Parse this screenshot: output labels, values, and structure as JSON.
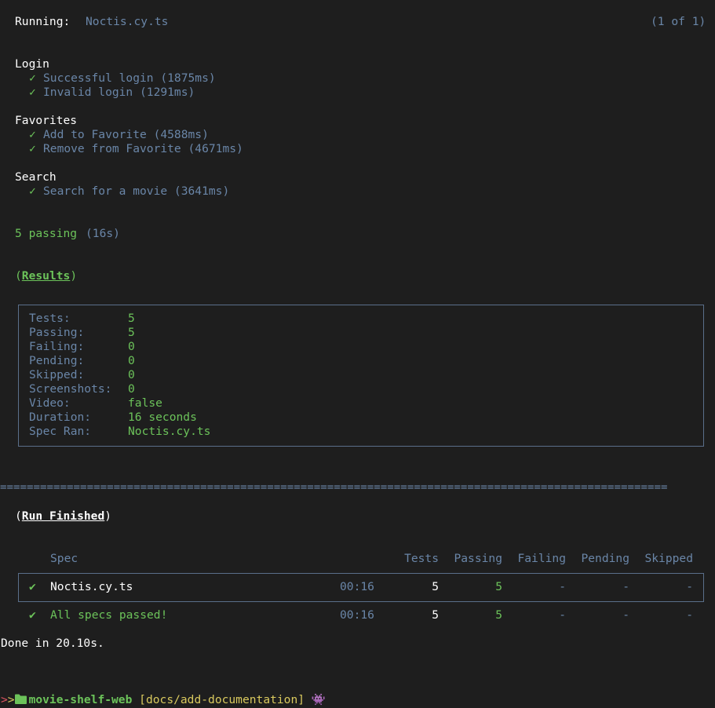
{
  "header": {
    "running_label": "Running:",
    "running_spec": "Noctis.cy.ts",
    "progress": "(1 of 1)"
  },
  "suites": [
    {
      "name": "Login",
      "tests": [
        {
          "mark": "✓",
          "text": "Successful login (1875ms)"
        },
        {
          "mark": "✓",
          "text": "Invalid login (1291ms)"
        }
      ]
    },
    {
      "name": "Favorites",
      "tests": [
        {
          "mark": "✓",
          "text": "Add to Favorite (4588ms)"
        },
        {
          "mark": "✓",
          "text": "Remove from Favorite (4671ms)"
        }
      ]
    },
    {
      "name": "Search",
      "tests": [
        {
          "mark": "✓",
          "text": "Search for a movie (3641ms)"
        }
      ]
    }
  ],
  "summary": {
    "passing": "5 passing",
    "duration": "(16s)"
  },
  "results": {
    "open_paren": "(",
    "title": "Results",
    "close_paren": ")",
    "rows": [
      {
        "label": "Tests:",
        "value": "5"
      },
      {
        "label": "Passing:",
        "value": "5"
      },
      {
        "label": "Failing:",
        "value": "0"
      },
      {
        "label": "Pending:",
        "value": "0"
      },
      {
        "label": "Skipped:",
        "value": "0"
      },
      {
        "label": "Screenshots:",
        "value": "0"
      },
      {
        "label": "Video:",
        "value": "false"
      },
      {
        "label": "Duration:",
        "value": "16 seconds"
      },
      {
        "label": "Spec Ran:",
        "value": "Noctis.cy.ts"
      }
    ]
  },
  "separator": "====================================================================================================",
  "run_finished": {
    "open_paren": "(",
    "title": "Run Finished",
    "close_paren": ")",
    "headers": {
      "spec": "Spec",
      "tests": "Tests",
      "passing": "Passing",
      "failing": "Failing",
      "pending": "Pending",
      "skipped": "Skipped"
    },
    "rows": [
      {
        "mark": "✔",
        "spec": "Noctis.cy.ts",
        "time": "00:16",
        "tests": "5",
        "passing": "5",
        "failing": "-",
        "pending": "-",
        "skipped": "-"
      },
      {
        "mark": "✔",
        "spec": "All specs passed!",
        "time": "00:16",
        "tests": "5",
        "passing": "5",
        "failing": "-",
        "pending": "-",
        "skipped": "-"
      }
    ]
  },
  "done": "Done in 20.10s.",
  "prompt": {
    "directory": "movie-shelf-web",
    "branch": "[docs/add-documentation]",
    "emoji": "👾",
    "arrows": ">>>"
  },
  "colors": {
    "background": "#1e1e1e",
    "green": "#6cc35a",
    "blue": "#6a86a8",
    "yellow": "#d9c95e",
    "border": "#5a6f8a"
  }
}
